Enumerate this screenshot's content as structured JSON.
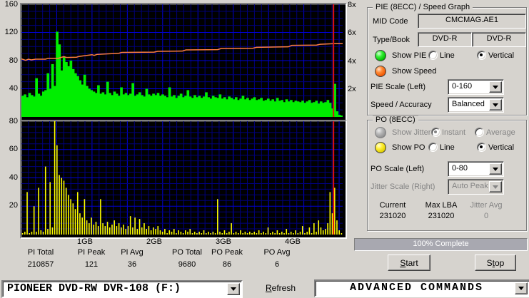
{
  "pie_panel": {
    "title": "PIE (8ECC) / Speed Graph",
    "mid_code_label": "MID Code",
    "mid_code_value": "CMCMAG.AE1",
    "type_book_label": "Type/Book",
    "type_value": "DVD-R",
    "book_value": "DVD-R",
    "show_pie_label": "Show PIE",
    "show_speed_label": "Show Speed",
    "line_label": "Line",
    "vertical_label": "Vertical",
    "pie_scale_label": "PIE Scale (Left)",
    "pie_scale_value": "0-160",
    "speed_accuracy_label": "Speed / Accuracy",
    "speed_accuracy_value": "Balanced"
  },
  "po_panel": {
    "title": "PO (8ECC)",
    "show_jitter_label": "Show Jitter",
    "instant_label": "Instant",
    "average_label": "Average",
    "show_po_label": "Show PO",
    "line_label": "Line",
    "vertical_label": "Vertical",
    "po_scale_label": "PO Scale (Left)",
    "po_scale_value": "0-80",
    "jitter_scale_label": "Jitter Scale (Right)",
    "jitter_scale_value": "Auto Peak",
    "current_label": "Current",
    "current_value": "231020",
    "max_lba_label": "Max LBA",
    "max_lba_value": "231020",
    "jitter_avg_label": "Jitter Avg",
    "jitter_avg_value": "0"
  },
  "progress": {
    "text": "100% Complete",
    "percent": 100
  },
  "buttons": {
    "start_u": "S",
    "start_rest": "tart",
    "stop_pre": "S",
    "stop_u": "t",
    "stop_rest": "op",
    "refresh_u": "R",
    "refresh_rest": "efresh"
  },
  "stats": {
    "items": [
      {
        "label": "PI Total",
        "value": "210857"
      },
      {
        "label": "PI Peak",
        "value": "121"
      },
      {
        "label": "PI Avg",
        "value": "36"
      },
      {
        "label": "PO Total",
        "value": "9680"
      },
      {
        "label": "PO Peak",
        "value": "86"
      },
      {
        "label": "PO Avg",
        "value": "6"
      }
    ]
  },
  "drive_combo_value": "PIONEER DVD-RW  DVR-108  (F:)",
  "commands_combo_value": "ADVANCED COMMANDS",
  "colors": {
    "dialog_bg": "#d6d3ce",
    "chart_bg": "#000000",
    "minor_grid": "#00007c",
    "major_grid": "#0000d8",
    "pie_green": "#00ee00",
    "speed_orange": "#ff7f40",
    "po_yellow": "#ffff00",
    "marker_red": "#dd1111",
    "progress_fill": "#a8a8b0"
  },
  "chart_data": [
    {
      "id": "pie_speed",
      "type": "area",
      "title": "PIE (8ECC) / Speed Graph",
      "x_unit": "GB",
      "x_max": 4.55,
      "x_minor_step": 0.1,
      "x_major_step": 0.5,
      "x_tick_labels": [
        "1GB",
        "2GB",
        "3GB",
        "4GB"
      ],
      "x_tick_values": [
        1,
        2,
        3,
        4
      ],
      "left_axis": {
        "range": [
          0,
          160
        ],
        "minor_step": 10,
        "major_step": 40,
        "tick_labels": [
          "160",
          "120",
          "80",
          "40"
        ],
        "tick_values": [
          160,
          120,
          80,
          40
        ]
      },
      "right_axis": {
        "range": [
          0,
          8
        ],
        "tick_labels": [
          "8x",
          "6x",
          "4x",
          "2x"
        ],
        "tick_values": [
          8,
          6,
          4,
          2
        ]
      },
      "marker_x": 4.42,
      "pie_values": [
        30,
        32,
        28,
        34,
        31,
        29,
        55,
        33,
        30,
        36,
        38,
        62,
        40,
        75,
        44,
        121,
        103,
        66,
        85,
        78,
        72,
        80,
        68,
        62,
        58,
        52,
        46,
        60,
        44,
        40,
        38,
        36,
        34,
        45,
        33,
        35,
        32,
        50,
        34,
        31,
        36,
        33,
        30,
        42,
        32,
        34,
        31,
        33,
        48,
        30,
        32,
        35,
        31,
        29,
        40,
        32,
        30,
        33,
        31,
        34,
        30,
        32,
        30,
        28,
        42,
        29,
        31,
        27,
        30,
        33,
        28,
        30,
        38,
        29,
        27,
        31,
        28,
        30,
        27,
        29,
        35,
        28,
        26,
        30,
        28,
        27,
        32,
        26,
        28,
        25,
        29,
        27,
        25,
        28,
        24,
        26,
        30,
        25,
        27,
        24,
        26,
        28,
        24,
        25,
        27,
        23,
        24,
        26,
        23,
        25,
        22,
        27,
        23,
        24,
        21,
        25,
        22,
        24,
        21,
        23,
        22,
        21,
        23,
        20,
        22,
        24,
        20,
        21,
        23,
        19,
        22,
        20,
        21,
        24,
        20,
        12,
        47,
        8,
        3,
        2
      ],
      "speed_points": [
        [
          0,
          4.12
        ],
        [
          0.06,
          4.02
        ],
        [
          0.1,
          4.1
        ],
        [
          0.14,
          4.05
        ],
        [
          0.2,
          4.1
        ],
        [
          0.34,
          4.1
        ],
        [
          0.38,
          4.16
        ],
        [
          0.52,
          4.16
        ],
        [
          0.56,
          4.22
        ],
        [
          0.6,
          4.28
        ],
        [
          0.64,
          4.22
        ],
        [
          0.78,
          4.24
        ],
        [
          0.82,
          4.3
        ],
        [
          1.0,
          4.42
        ],
        [
          1.03,
          4.37
        ],
        [
          1.07,
          4.44
        ],
        [
          1.38,
          4.52
        ],
        [
          1.42,
          4.58
        ],
        [
          1.88,
          4.6
        ],
        [
          1.93,
          4.66
        ],
        [
          2.28,
          4.68
        ],
        [
          2.33,
          4.76
        ],
        [
          2.78,
          4.78
        ],
        [
          2.83,
          4.86
        ],
        [
          3.28,
          4.88
        ],
        [
          3.33,
          4.94
        ],
        [
          3.78,
          4.98
        ],
        [
          3.83,
          5.08
        ],
        [
          4.18,
          5.1
        ],
        [
          4.23,
          5.16
        ],
        [
          4.42,
          5.2
        ],
        [
          4.55,
          5.2
        ]
      ]
    },
    {
      "id": "po",
      "type": "bar",
      "title": "PO (8ECC)",
      "x_unit": "GB",
      "x_max": 4.55,
      "x_minor_step": 0.1,
      "x_major_step": 0.5,
      "left_axis": {
        "range": [
          0,
          80
        ],
        "minor_step": 4,
        "major_step": 20,
        "tick_labels": [
          "80",
          "60",
          "40",
          "20"
        ],
        "tick_values": [
          80,
          60,
          40,
          20
        ]
      },
      "marker_x": 4.42,
      "po_values": [
        1,
        2,
        30,
        1,
        2,
        20,
        2,
        33,
        3,
        2,
        48,
        4,
        37,
        5,
        80,
        63,
        42,
        40,
        38,
        33,
        28,
        25,
        22,
        18,
        30,
        15,
        12,
        25,
        10,
        8,
        12,
        7,
        9,
        6,
        25,
        8,
        6,
        9,
        5,
        7,
        10,
        6,
        8,
        5,
        7,
        4,
        6,
        13,
        5,
        12,
        4,
        11,
        5,
        8,
        4,
        6,
        3,
        5,
        4,
        6,
        3,
        2,
        4,
        1,
        3,
        2,
        4,
        1,
        3,
        2,
        1,
        3,
        2,
        4,
        1,
        2,
        1,
        2,
        1,
        3,
        1,
        2,
        1,
        2,
        1,
        25,
        2,
        1,
        3,
        1,
        2,
        8,
        1,
        2,
        1,
        3,
        1,
        2,
        1,
        2,
        1,
        2,
        1,
        3,
        1,
        2,
        1,
        5,
        1,
        2,
        1,
        3,
        1,
        2,
        1,
        4,
        1,
        2,
        1,
        3,
        1,
        2,
        6,
        1,
        2,
        5,
        1,
        8,
        2,
        10,
        5,
        3,
        4,
        8,
        30,
        15,
        33,
        10,
        3,
        1
      ]
    }
  ]
}
